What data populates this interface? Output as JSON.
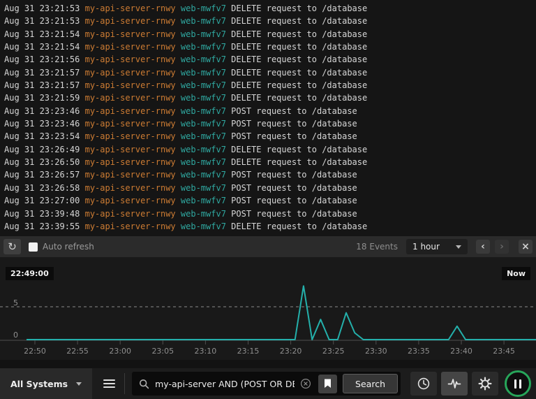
{
  "colors": {
    "accent_teal": "#24b0ab",
    "accent_orange": "#cd7c33",
    "program_teal": "#2fa8a0",
    "log_text": "#d6d6d6",
    "grid_dashed": "#8a8a8a",
    "axis": "#4f4f4f",
    "tick_label": "#8f8f8f",
    "pause_ring_green": "#27a65a"
  },
  "log": {
    "rows": [
      {
        "timestamp": "Aug 31 23:21:53",
        "system": "my-api-server-rnwy",
        "program": "web-mwfv7",
        "message": "DELETE request to /database"
      },
      {
        "timestamp": "Aug 31 23:21:53",
        "system": "my-api-server-rnwy",
        "program": "web-mwfv7",
        "message": "DELETE request to /database"
      },
      {
        "timestamp": "Aug 31 23:21:54",
        "system": "my-api-server-rnwy",
        "program": "web-mwfv7",
        "message": "DELETE request to /database"
      },
      {
        "timestamp": "Aug 31 23:21:54",
        "system": "my-api-server-rnwy",
        "program": "web-mwfv7",
        "message": "DELETE request to /database"
      },
      {
        "timestamp": "Aug 31 23:21:56",
        "system": "my-api-server-rnwy",
        "program": "web-mwfv7",
        "message": "DELETE request to /database"
      },
      {
        "timestamp": "Aug 31 23:21:57",
        "system": "my-api-server-rnwy",
        "program": "web-mwfv7",
        "message": "DELETE request to /database"
      },
      {
        "timestamp": "Aug 31 23:21:57",
        "system": "my-api-server-rnwy",
        "program": "web-mwfv7",
        "message": "DELETE request to /database"
      },
      {
        "timestamp": "Aug 31 23:21:59",
        "system": "my-api-server-rnwy",
        "program": "web-mwfv7",
        "message": "DELETE request to /database"
      },
      {
        "timestamp": "Aug 31 23:23:46",
        "system": "my-api-server-rnwy",
        "program": "web-mwfv7",
        "message": "POST request to /database"
      },
      {
        "timestamp": "Aug 31 23:23:46",
        "system": "my-api-server-rnwy",
        "program": "web-mwfv7",
        "message": "POST request to /database"
      },
      {
        "timestamp": "Aug 31 23:23:54",
        "system": "my-api-server-rnwy",
        "program": "web-mwfv7",
        "message": "POST request to /database"
      },
      {
        "timestamp": "Aug 31 23:26:49",
        "system": "my-api-server-rnwy",
        "program": "web-mwfv7",
        "message": "DELETE request to /database"
      },
      {
        "timestamp": "Aug 31 23:26:50",
        "system": "my-api-server-rnwy",
        "program": "web-mwfv7",
        "message": "DELETE request to /database"
      },
      {
        "timestamp": "Aug 31 23:26:57",
        "system": "my-api-server-rnwy",
        "program": "web-mwfv7",
        "message": "POST request to /database"
      },
      {
        "timestamp": "Aug 31 23:26:58",
        "system": "my-api-server-rnwy",
        "program": "web-mwfv7",
        "message": "POST request to /database"
      },
      {
        "timestamp": "Aug 31 23:27:00",
        "system": "my-api-server-rnwy",
        "program": "web-mwfv7",
        "message": "POST request to /database"
      },
      {
        "timestamp": "Aug 31 23:39:48",
        "system": "my-api-server-rnwy",
        "program": "web-mwfv7",
        "message": "POST request to /database"
      },
      {
        "timestamp": "Aug 31 23:39:55",
        "system": "my-api-server-rnwy",
        "program": "web-mwfv7",
        "message": "DELETE request to /database"
      }
    ]
  },
  "toolbar": {
    "auto_refresh_label": "Auto refresh",
    "auto_refresh_checked": false,
    "events_count": "18 Events",
    "time_range": "1 hour"
  },
  "icons": {
    "refresh": "↻",
    "prev": "‹",
    "next": "›",
    "close": "×"
  },
  "chart_data": {
    "type": "line",
    "start_time": "22:49",
    "interval_minutes": 1,
    "values": [
      0,
      0,
      0,
      0,
      0,
      0,
      0,
      0,
      0,
      0,
      0,
      0,
      0,
      0,
      0,
      0,
      0,
      0,
      0,
      0,
      0,
      0,
      0,
      0,
      0,
      0,
      0,
      0,
      0,
      0,
      0,
      0,
      8,
      0,
      3,
      0,
      0,
      4,
      1,
      0,
      0,
      0,
      0,
      0,
      0,
      0,
      0,
      0,
      0,
      0,
      2,
      0,
      0,
      0,
      0,
      0,
      0,
      0,
      0,
      0
    ],
    "x_ticks": [
      "22:50",
      "22:55",
      "23:00",
      "23:05",
      "23:10",
      "23:15",
      "23:20",
      "23:25",
      "23:30",
      "23:35",
      "23:40",
      "23:45"
    ],
    "y_ticks": [
      0,
      5
    ],
    "ylim": [
      0,
      8.5
    ],
    "gridline_value": 5,
    "grid": "dashed-horizontal-at-5",
    "legend": "none",
    "start_time_label": "22:49:00",
    "now_label": "Now"
  },
  "bottom_bar": {
    "systems_dropdown_label": "All Systems",
    "search_query": "my-api-server AND (POST OR DELETE)",
    "search_button_label": "Search"
  }
}
